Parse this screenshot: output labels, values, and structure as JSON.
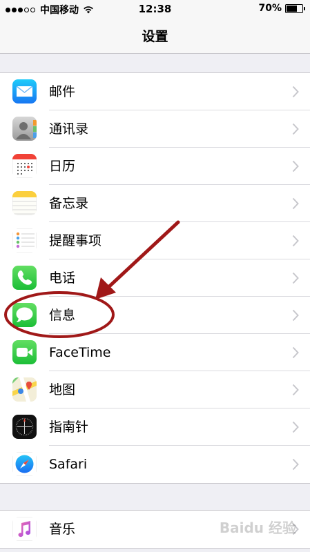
{
  "status_bar": {
    "carrier": "中国移动",
    "time": "12:38",
    "battery": "70%",
    "battery_level": 0.7
  },
  "nav": {
    "title": "设置"
  },
  "group1": [
    {
      "label": "邮件",
      "icon": "mail-icon"
    },
    {
      "label": "通讯录",
      "icon": "contacts-icon"
    },
    {
      "label": "日历",
      "icon": "calendar-icon"
    },
    {
      "label": "备忘录",
      "icon": "notes-icon"
    },
    {
      "label": "提醒事项",
      "icon": "reminders-icon"
    },
    {
      "label": "电话",
      "icon": "phone-icon"
    },
    {
      "label": "信息",
      "icon": "messages-icon"
    },
    {
      "label": "FaceTime",
      "icon": "facetime-icon"
    },
    {
      "label": "地图",
      "icon": "maps-icon"
    },
    {
      "label": "指南针",
      "icon": "compass-icon"
    },
    {
      "label": "Safari",
      "icon": "safari-icon"
    }
  ],
  "group2": [
    {
      "label": "音乐",
      "icon": "music-icon"
    }
  ],
  "watermark": "Baidu 经验",
  "colors": {
    "background": "#efeff4",
    "annotation_red": "#a01818",
    "separator": "#c8c7cc",
    "chevron": "#c7c7cc"
  }
}
